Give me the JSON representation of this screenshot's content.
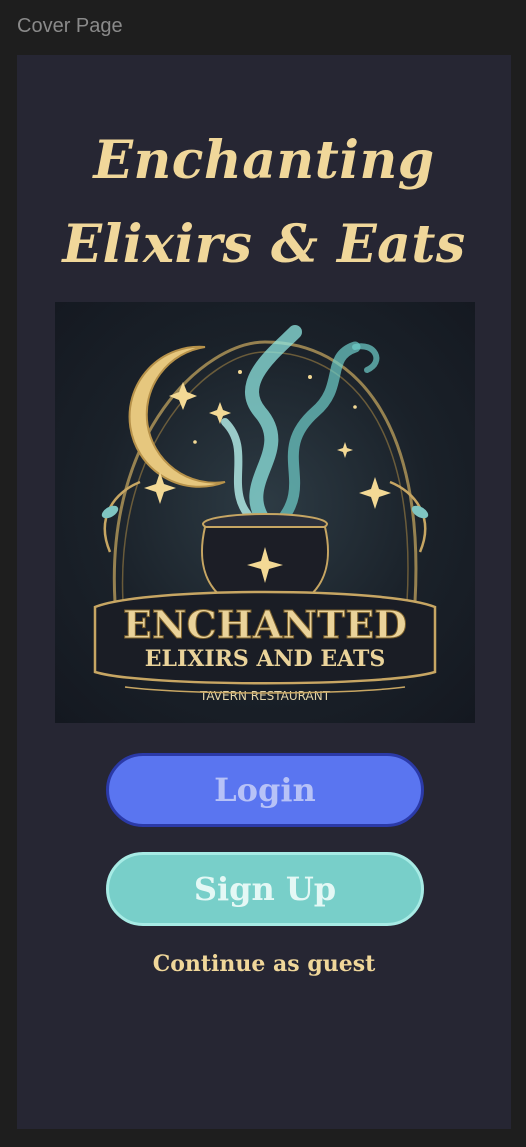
{
  "frame": {
    "label": "Cover Page"
  },
  "cover": {
    "title": "Enchanting Elixirs & Eats",
    "logo": {
      "icon": "cauldron-moon-logo",
      "line1": "ENCHANTED",
      "line2": "ELIXIRS AND EATS",
      "tagline": "TAVERN RESTAURANT"
    },
    "login_label": "Login",
    "signup_label": "Sign Up",
    "guest_label": "Continue as guest"
  },
  "colors": {
    "background": "#262633",
    "title": "#f0d79a",
    "login_button": "#5a75f0",
    "signup_button": "#78cfc9"
  }
}
